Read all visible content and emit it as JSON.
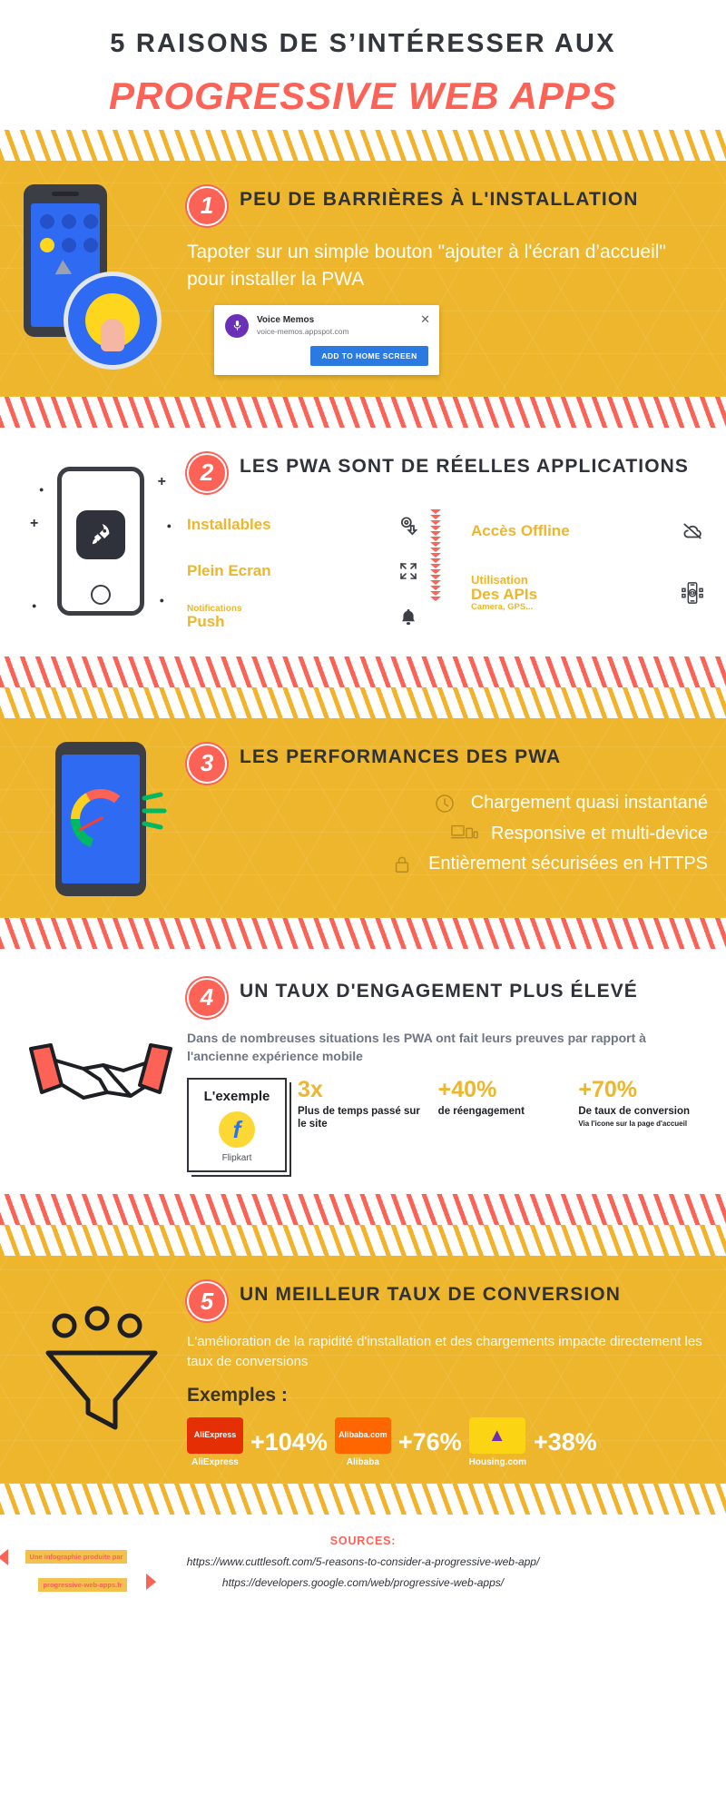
{
  "header": {
    "line1": "5 RAISONS DE S’INTÉRESSER AUX",
    "line2": "PROGRESSIVE WEB APPS"
  },
  "colors": {
    "yellow": "#edb62c",
    "coral": "#fc6256",
    "dark": "#2f323a",
    "blue": "#2f6bf2",
    "chrome_blue": "#2a7ae2"
  },
  "sections": [
    {
      "number": "1",
      "title": "PEU DE BARRIÈRES À L'INSTALLATION",
      "description": "Tapoter sur un simple bouton \"ajouter à l'écran d’accueil\" pour installer la PWA",
      "chrome_banner": {
        "app_name": "Voice Memos",
        "url": "voice-memos.appspot.com",
        "button_label": "ADD TO HOME SCREEN",
        "close_label": "✕",
        "icon": "microphone-icon"
      }
    },
    {
      "number": "2",
      "title": "LES PWA SONT DE RÉELLES APPLICATIONS",
      "features_left": [
        {
          "small": "",
          "big": "Installables",
          "icon": "install-gear-icon"
        },
        {
          "small": "",
          "big": "Plein Ecran",
          "icon": "fullscreen-icon"
        },
        {
          "small": "Notifications",
          "big": "Push",
          "icon": "bell-icon"
        }
      ],
      "features_right": [
        {
          "small": "",
          "big": "Accès Offline",
          "sub": "",
          "icon": "cloud-off-icon"
        },
        {
          "small": "Utilisation",
          "big": "Des APIs",
          "sub": "Camera, GPS...",
          "icon": "api-device-icon"
        }
      ]
    },
    {
      "number": "3",
      "title": "LES PERFORMANCES DES PWA",
      "items": [
        {
          "text": "Chargement quasi instantané",
          "icon": "clock-icon"
        },
        {
          "text": "Responsive et multi-device",
          "icon": "devices-icon"
        },
        {
          "text": "Entièrement sécurisées en HTTPS",
          "icon": "lock-icon"
        }
      ]
    },
    {
      "number": "4",
      "title": "UN TAUX D'ENGAGEMENT PLUS ÉLEVÉ",
      "description": "Dans de nombreuses situations les PWA ont fait leurs preuves par rapport à l'ancienne expérience mobile",
      "example": {
        "title": "L'exemple",
        "brand": "Flipkart",
        "logo_glyph": "f"
      },
      "stats": [
        {
          "value": "3x",
          "label": "Plus de temps passé sur le site",
          "sub": ""
        },
        {
          "value": "+40%",
          "label": "de réengagement",
          "sub": ""
        },
        {
          "value": "+70%",
          "label": "De taux de conversion",
          "sub": "Via l'icone sur la page d'accueil"
        }
      ]
    },
    {
      "number": "5",
      "title": "UN MEILLEUR TAUX DE CONVERSION",
      "description": "L'amélioration de la rapidité d'installation et des chargements impacte directement les taux de conversions",
      "examples_label": "Exemples :",
      "brands": [
        {
          "name": "AliExpress",
          "logo_text": "AliExpress",
          "percent": "+104%",
          "color": "#e62e04"
        },
        {
          "name": "Alibaba",
          "logo_text": "Alibaba.com",
          "percent": "+76%",
          "color": "#f60"
        },
        {
          "name": "Housing.com",
          "logo_text": "▲",
          "percent": "+38%",
          "color": "#fbd414"
        }
      ]
    }
  ],
  "footer": {
    "sources_title": "SOURCES:",
    "source_1": "https://www.cuttlesoft.com/5-reasons-to-consider-a-progressive-web-app/",
    "source_2": "https://developers.google.com/web/progressive-web-apps/",
    "ribbon_top": "Une infographie produite par",
    "ribbon_bottom": "progressive-web-apps.fr"
  }
}
